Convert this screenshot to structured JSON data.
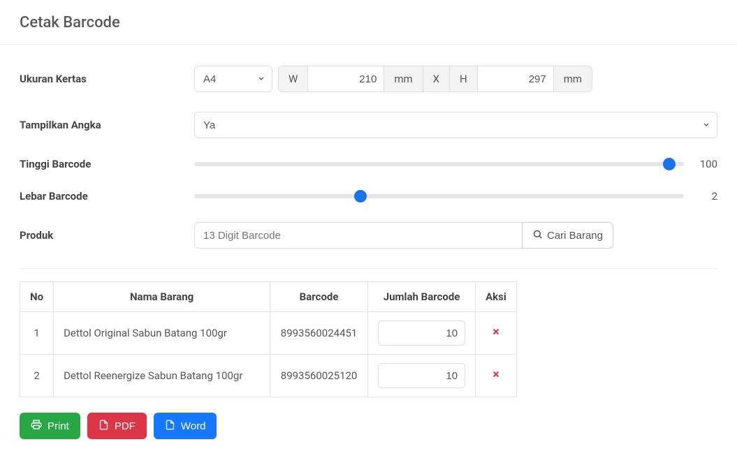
{
  "header": {
    "title": "Cetak Barcode"
  },
  "form": {
    "ukuran_label": "Ukuran Kertas",
    "paper_select": "A4",
    "w_label": "W",
    "w_value": "210",
    "mm1": "mm",
    "x_label": "X",
    "h_label": "H",
    "h_value": "297",
    "mm2": "mm",
    "tampilkan_label": "Tampilkan Angka",
    "tampilkan_value": "Ya",
    "tinggi_label": "Tinggi Barcode",
    "tinggi_value": "100",
    "tinggi_pct": 97,
    "lebar_label": "Lebar Barcode",
    "lebar_value": "2",
    "lebar_pct": 34,
    "produk_label": "Produk",
    "produk_placeholder": "13 Digit Barcode",
    "cari_label": "Cari Barang"
  },
  "table": {
    "headers": {
      "no": "No",
      "nama": "Nama Barang",
      "barcode": "Barcode",
      "jumlah": "Jumlah Barcode",
      "aksi": "Aksi"
    },
    "rows": [
      {
        "no": "1",
        "nama": "Dettol Original Sabun Batang 100gr",
        "barcode": "8993560024451",
        "jumlah": "10"
      },
      {
        "no": "2",
        "nama": "Dettol Reenergize Sabun Batang 100gr",
        "barcode": "8993560025120",
        "jumlah": "10"
      }
    ]
  },
  "actions": {
    "print": "Print",
    "pdf": "PDF",
    "word": "Word"
  }
}
